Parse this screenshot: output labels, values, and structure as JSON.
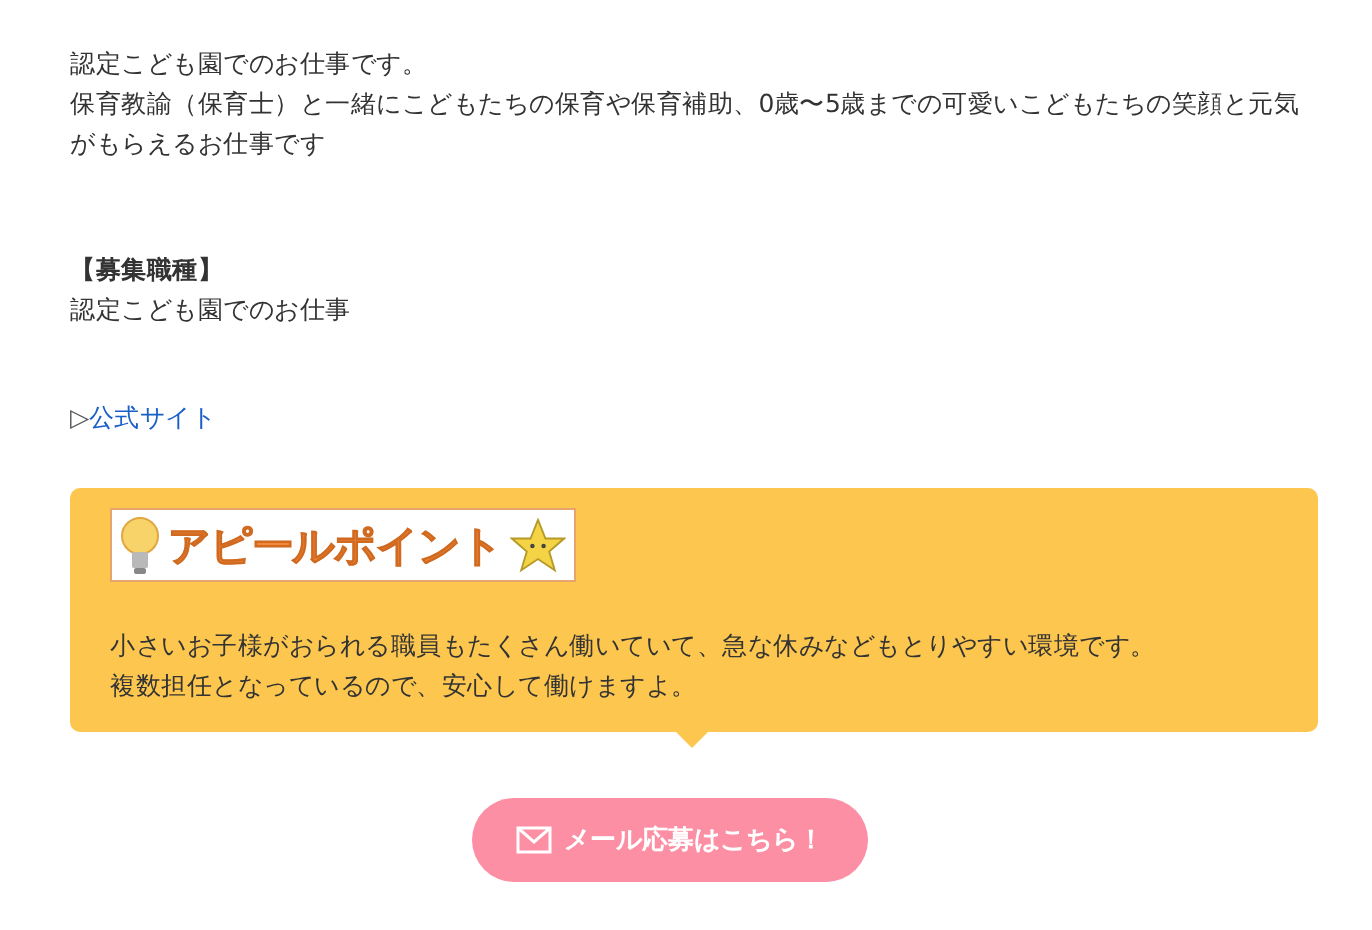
{
  "intro": [
    "認定こども園でのお仕事です。",
    "保育教諭（保育士）と一緒にこどもたちの保育や保育補助、0歳〜5歳までの可愛いこどもたちの笑顔と元気がもらえるお仕事です"
  ],
  "section": {
    "heading": "【募集職種】",
    "text": "認定こども園でのお仕事"
  },
  "link": {
    "marker": "▷",
    "label": "公式サイト"
  },
  "appeal": {
    "banner": "アピールポイント",
    "lines": [
      "小さいお子様がおられる職員もたくさん働いていて、急な休みなどもとりやすい環境です。",
      "複数担任となっているので、安心して働けますよ。"
    ]
  },
  "apply_button": {
    "label": "メール応募はこちら！"
  }
}
